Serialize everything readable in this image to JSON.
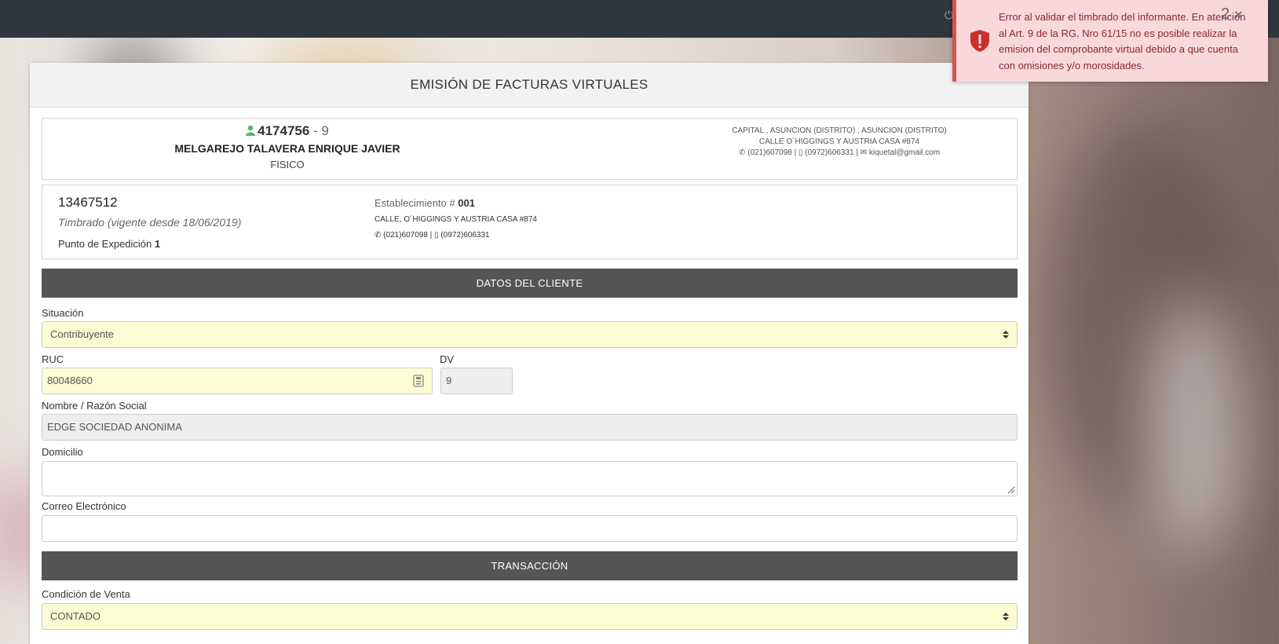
{
  "header": {
    "title": "EMISIÓN DE FACTURAS VIRTUALES"
  },
  "owner": {
    "ruc": "4174756",
    "dv_separator": " - 9",
    "name": "MELGAREJO TALAVERA ENRIQUE JAVIER",
    "type": "FISICO",
    "address_line1": "CAPITAL , ASUNCION (DISTRITO) , ASUNCION (DISTRITO)",
    "address_line2": "CALLE O´HIGGINGS Y AUSTRIA CASA #874",
    "contact_line": "(021)607098 | ▯ (0972)606331 | ✉ kiquetal@gmail.com"
  },
  "timbrado": {
    "number": "13467512",
    "validity": "Timbrado (vigente desde 18/06/2019)",
    "punto_label": "Punto de Expedición ",
    "punto_value": "1",
    "est_label": "Establecimiento # ",
    "est_value": "001",
    "est_address": "CALLE, O´HIGGINGS Y AUSTRIA CASA #874",
    "est_phones": "(021)607098 | ▯ (0972)606331"
  },
  "client_section": {
    "title": "DATOS DEL CLIENTE",
    "situacion_label": "Situación",
    "situacion_value": "Contribuyente",
    "ruc_label": "RUC",
    "ruc_value": "80048660",
    "dv_label": "DV",
    "dv_value": "9",
    "nombre_label": "Nombre / Razón Social",
    "nombre_value": "EDGE SOCIEDAD ANONIMA",
    "domicilio_label": "Domicilio",
    "domicilio_value": "",
    "correo_label": "Correo Electrónico",
    "correo_value": ""
  },
  "transaction_section": {
    "title": "TRANSACCIÓN",
    "condicion_label": "Condición de Venta",
    "condicion_value": "CONTADO"
  },
  "toast": {
    "message": "Error al validar el timbrado del informante. En atencion al Art. 9 de la RG. Nro 61/15 no es posible realizar la emision del comprobante virtual debido a que cuenta con omisiones y/o morosidades.",
    "count": "2",
    "close": "×"
  },
  "colors": {
    "topbar": "#2f363d",
    "section_bar": "#555555",
    "highlight_field": "#fcfcd4",
    "toast_bg": "#f8d8da",
    "toast_border": "#d9534f",
    "user_icon": "#5cb85c"
  }
}
